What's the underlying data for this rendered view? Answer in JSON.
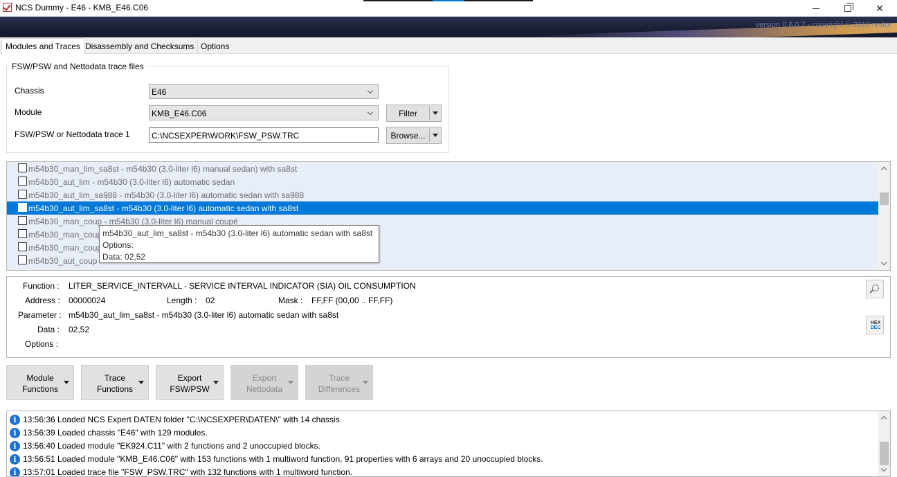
{
  "window": {
    "title": "NCS Dummy - E46 - KMB_E46.C06",
    "app_icon": "checkbox-check-icon"
  },
  "banner": {
    "version_text": "version 0.6.0.7 - copyright © 2016 revtor"
  },
  "tabs": [
    {
      "label": "Modules and Traces",
      "active": true
    },
    {
      "label": "Disassembly and Checksums",
      "active": false
    },
    {
      "label": "Options",
      "active": false
    }
  ],
  "trace_group": {
    "title": "FSW/PSW and Nettodata trace files",
    "chassis_label": "Chassis",
    "chassis_value": "E46",
    "module_label": "Module",
    "module_value": "KMB_E46.C06",
    "trace_label": "FSW/PSW or Nettodata trace 1",
    "trace_value": "C:\\NCSEXPER\\WORK\\FSW_PSW.TRC",
    "filter_label": "Filter",
    "browse_label": "Browse..."
  },
  "parameters": [
    {
      "label": "m54b30_man_lim_sa8st  -  m54b30 (3.0-liter l6) manual sedan) with sa8st",
      "selected": false
    },
    {
      "label": "m54b30_aut_lim  -  m54b30 (3.0-liter l6) automatic sedan",
      "selected": false
    },
    {
      "label": "m54b30_aut_lim_sa988  -  m54b30 (3.0-liter l6) automatic sedan with sa988",
      "selected": false
    },
    {
      "label": "m54b30_aut_lim_sa8st  -  m54b30 (3.0-liter l6) automatic sedan with sa8st",
      "selected": true
    },
    {
      "label": "m54b30_man_coup  -  m54b30 (3.0-liter l6) manual coupé",
      "selected": false
    },
    {
      "label": "m54b30_man_coup",
      "selected": false
    },
    {
      "label": "m54b30_man_coup",
      "selected": false
    },
    {
      "label": "m54b30_aut_coup",
      "selected": false
    }
  ],
  "tooltip": {
    "line1": "m54b30_aut_lim_sa8st  -  m54b30 (3.0-liter l6) automatic sedan with sa8st",
    "line2": "Options:",
    "line3": "Data: 02,52"
  },
  "detail": {
    "function_label": "Function :",
    "function_value": "LITER_SERVICE_INTERVALL  -  SERVICE INTERVAL INDICATOR (SIA) OIL CONSUMPTION",
    "address_label": "Address :",
    "address_value": "00000024",
    "length_label": "Length :",
    "length_value": "02",
    "mask_label": "Mask :",
    "mask_value": "FF,FF  (00,00 .. FF,FF)",
    "parameter_label": "Parameter :",
    "parameter_value": "m54b30_aut_lim_sa8st  -  m54b30 (3.0-liter l6) automatic sedan with sa8st",
    "data_label": "Data :",
    "data_value": "02,52",
    "options_label": "Options :",
    "hex_text": "HEX",
    "dec_text": "DEC"
  },
  "function_buttons": [
    {
      "label": "Module\nFunctions",
      "enabled": true
    },
    {
      "label": "Trace\nFunctions",
      "enabled": true
    },
    {
      "label": "Export\nFSW/PSW",
      "enabled": true
    },
    {
      "label": "Export\nNettodata",
      "enabled": false
    },
    {
      "label": "Trace\nDifferences",
      "enabled": false
    }
  ],
  "log": [
    "13:56:36  Loaded NCS Expert DATEN folder \"C:\\NCSEXPER\\DATEN\\\" with 14 chassis.",
    "13:56:39  Loaded chassis \"E46\" with 129 modules.",
    "13:56:40  Loaded module \"EK924.C11\" with 2 functions and 2 unoccupied blocks.",
    "13:56:51  Loaded module \"KMB_E46.C06\" with 153 functions with 1 multiword function, 91 properties with 6 arrays and 20 unoccupied blocks.",
    "13:57:01  Loaded trace file \"FSW_PSW.TRC\" with 132 functions with 1 multiword function."
  ],
  "colors": {
    "selection": "#0078d7",
    "list_background": "#e8eef8",
    "info_icon": "#1f6fd0"
  }
}
